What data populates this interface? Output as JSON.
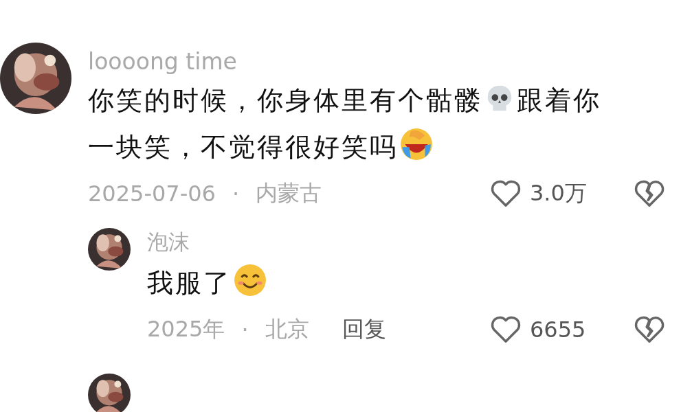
{
  "comments": [
    {
      "username": "loooong time",
      "avatar": {
        "kind": "picture"
      },
      "content": [
        {
          "kind": "text",
          "text": "你笑的时候，你身体里有个骷髅"
        },
        {
          "kind": "skull"
        },
        {
          "kind": "text",
          "text": "跟着你一块笑，不觉得很好笑吗"
        },
        {
          "kind": "laugh"
        }
      ],
      "date": "2025-07-06",
      "separator": "·",
      "location": "内蒙古",
      "likes": "3.0万",
      "replies": [
        {
          "username": "泡沫",
          "avatar": {
            "kind": "picture"
          },
          "content": [
            {
              "kind": "text",
              "text": "我服了"
            },
            {
              "kind": "smile"
            }
          ],
          "date": "2025年",
          "separator": "·",
          "location": "北京",
          "reply": "回复",
          "likes": "6655"
        }
      ]
    }
  ],
  "next_avatar": {
    "kind": "picture"
  }
}
